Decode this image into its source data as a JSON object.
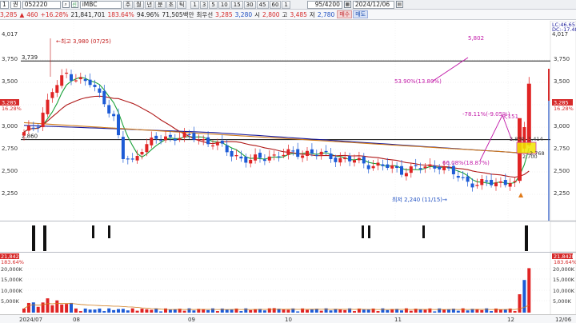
{
  "toolbar": {
    "index_label": "1",
    "type_label": "권",
    "code_value": "052220",
    "search_icon": "search-icon",
    "name_tag": "신",
    "stock_name": "iMBC",
    "period_buttons": [
      "주",
      "월",
      "년",
      "분",
      "초",
      "틱"
    ],
    "interval_buttons": [
      "1",
      "3",
      "5",
      "10",
      "15",
      "30",
      "45",
      "60",
      "1"
    ],
    "count_value": "95/4200",
    "date_value": "2024/12/06",
    "calendar_icon": "calendar-icon"
  },
  "quote": {
    "price": "3,285",
    "change": "460",
    "change_pct": "+16.28%",
    "volume": "21,841,701",
    "volume_pct": "183.64%",
    "strength": "94.96%",
    "amount": "71,505백만",
    "recent_label": "최우선",
    "best_ask": "3,285",
    "best_bid": "3,280",
    "open_label": "시",
    "open": "2,800",
    "high_label": "고",
    "high": "3,485",
    "low_label": "저",
    "low": "2,780",
    "buy_label": "매수",
    "sell_label": "매도"
  },
  "main_chart": {
    "left_top_label": "4,017",
    "right_top_label": "4,017",
    "right_legend": [
      "LC:46.65",
      "DC:-17.48"
    ],
    "y_ticks": [
      "3,750",
      "3,500",
      "3,250",
      "3,000",
      "2,750",
      "2,500",
      "2,250"
    ],
    "price_tag_left": "3,285",
    "price_tag_left_pct": "16.28%",
    "price_tag_right": "3,285",
    "price_tag_right_pct": "16.28%",
    "level_3739": "3,739",
    "level_2860": "2,860",
    "annotations": {
      "high": "최고 3,980 (07/25)",
      "low": "최저 2,240 (11/15)",
      "pct_53": "53.90%(13.80%)",
      "pct_66": "66.08%(18.87%)",
      "pct_78": "-78.11%(-9.05%)",
      "target": "5,802",
      "p3151": "3,151",
      "p2830": "2,830",
      "p2700": "2,700",
      "p3414": "3,414",
      "p2768": "2,768"
    },
    "colors": {
      "up": "#e02424",
      "down": "#1d5bd6",
      "ma5": "#1aa13a",
      "ma20": "#b01a1a",
      "ma60": "#1a1a9a",
      "ma120": "#d07a1a",
      "annotation": "#c21aa8"
    }
  },
  "volume_chart": {
    "left_top_label": "21,842K",
    "left_top_pct": "183.64%",
    "right_top_label": "21,842K",
    "right_top_pct": "183.64%",
    "y_ticks": [
      "20,000K",
      "15,000K",
      "10,000K",
      "5,000K"
    ]
  },
  "date_axis": {
    "labels": [
      "2024/07",
      "08",
      "09",
      "10",
      "11",
      "12",
      "12/06"
    ]
  }
}
